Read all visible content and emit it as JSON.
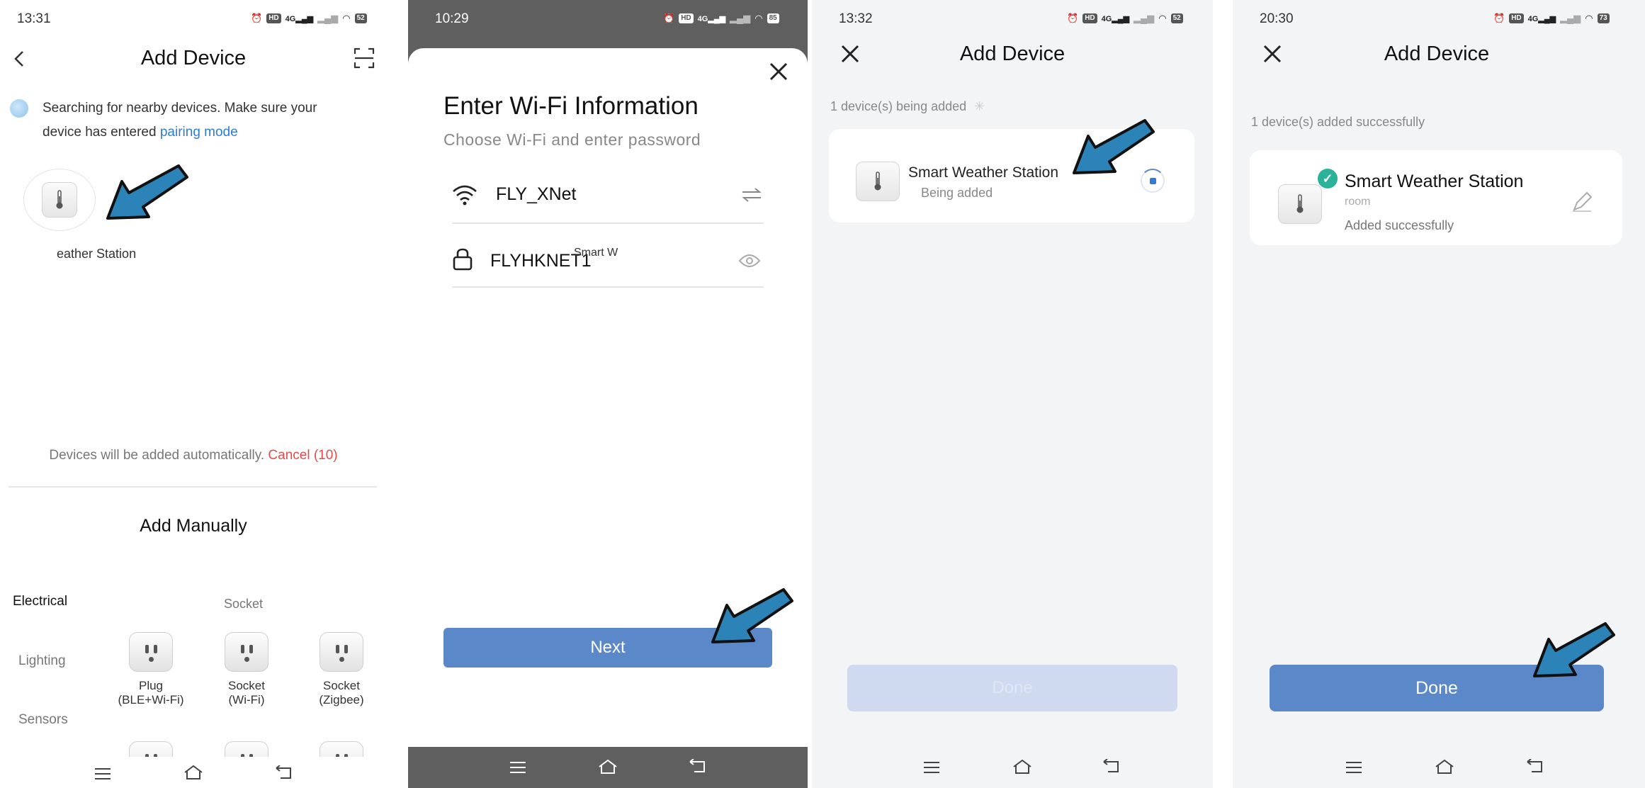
{
  "panel1": {
    "time": "13:31",
    "battery": "52",
    "title": "Add Device",
    "search_text": "Searching for nearby devices. Make sure your device has entered",
    "pairing_link": "pairing mode",
    "device_label": "eather Station",
    "auto_add_text": "Devices will be added automatically.",
    "cancel_label": "Cancel (10)",
    "manual_title": "Add Manually",
    "categories": [
      "Electrical",
      "Lighting",
      "Sensors"
    ],
    "subheader": "Socket",
    "items": [
      {
        "label": "Plug\n(BLE+Wi-Fi)"
      },
      {
        "label": "Socket\n(Wi-Fi)"
      },
      {
        "label": "Socket\n(Zigbee)"
      }
    ]
  },
  "panel2": {
    "time": "10:29",
    "battery": "85",
    "heading": "Enter Wi-Fi Information",
    "subheading": "Choose Wi-Fi and enter password",
    "wifi_name": "FLY_XNet",
    "password": "FLYHKNET1",
    "password_suffix": "Smart W",
    "next_label": "Next"
  },
  "panel3": {
    "time": "13:32",
    "battery": "52",
    "title": "Add Device",
    "status_text": "1 device(s) being added",
    "device_name": "Smart Weather Station",
    "device_status": "Being added",
    "done_label": "Done"
  },
  "panel4": {
    "time": "20:30",
    "battery": "73",
    "title": "Add Device",
    "status_text": "1 device(s) added successfully",
    "device_name": "Smart Weather Station",
    "device_room": "room",
    "device_status": "Added successfully",
    "done_label": "Done"
  },
  "colors": {
    "primary": "#5b88c9",
    "primary_disabled": "#cfdaf0",
    "link": "#2f7bd6",
    "cancel": "#e24b4b",
    "success": "#2bb39a",
    "arrow": "#2b83b8",
    "dark_bar": "#5f5f5f"
  },
  "icons": {
    "back": "chevron-left-icon",
    "scan": "scan-icon",
    "close": "close-icon",
    "wifi": "wifi-icon",
    "lock": "lock-icon",
    "swap": "swap-icon",
    "eye": "eye-icon",
    "thermometer": "thermometer-icon",
    "menu": "menu-icon",
    "home": "home-icon",
    "back_nav": "back-nav-icon",
    "edit": "pencil-icon",
    "check": "check-icon",
    "spinner": "spinner-icon"
  }
}
